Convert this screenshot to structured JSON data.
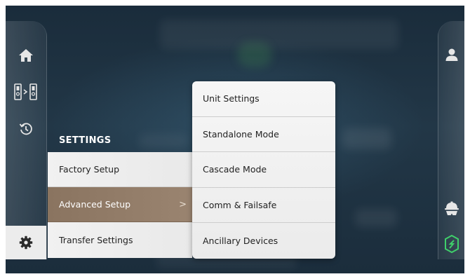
{
  "colors": {
    "background": "#1f3344",
    "menu_active": "#8e7864",
    "menu_item": "#eeeeee",
    "icon_light": "#e6e6e6",
    "brand_green": "#3fcf6a"
  },
  "left_nav": {
    "items": [
      {
        "icon": "home-icon"
      },
      {
        "icon": "boiler-transfer-icon"
      },
      {
        "icon": "history-icon"
      },
      {
        "icon": "gear-icon"
      }
    ]
  },
  "right_nav": {
    "items": [
      {
        "icon": "user-icon"
      },
      {
        "icon": "service-technician-icon"
      },
      {
        "icon": "brand-logo-icon"
      }
    ]
  },
  "settings": {
    "title": "SETTINGS",
    "items": [
      {
        "label": "Factory Setup"
      },
      {
        "label": "Advanced Setup",
        "chevron": ">"
      },
      {
        "label": "Transfer Settings"
      }
    ]
  },
  "submenu": {
    "items": [
      {
        "label": "Unit Settings"
      },
      {
        "label": "Standalone Mode"
      },
      {
        "label": "Cascade Mode"
      },
      {
        "label": "Comm & Failsafe"
      },
      {
        "label": "Ancillary Devices"
      }
    ]
  }
}
